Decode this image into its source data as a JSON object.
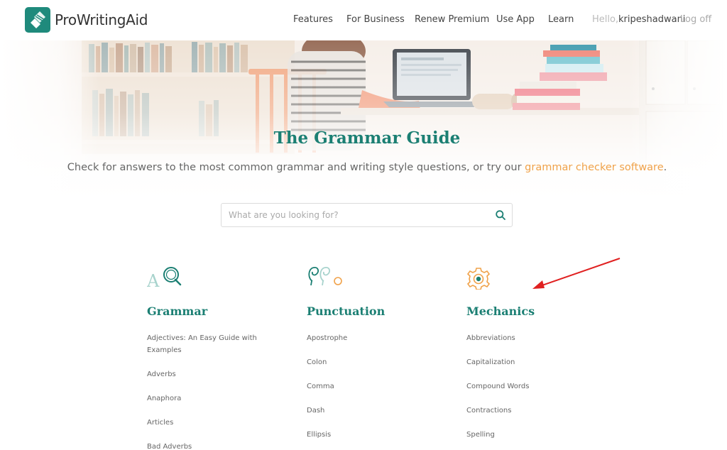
{
  "header": {
    "logo_text": "ProWritingAid",
    "nav": [
      "Features",
      "For Business",
      "Renew Premium",
      "Use App",
      "Learn"
    ],
    "hello": "Hello,",
    "username": "kripeshadwani",
    "logoff": "Log off"
  },
  "hero": {
    "title": "The Grammar Guide",
    "subtitle_prefix": "Check for answers to the most common grammar and writing style questions, or try our ",
    "subtitle_link": "grammar checker software",
    "subtitle_suffix": "."
  },
  "search": {
    "placeholder": "What are you looking for?"
  },
  "categories": [
    {
      "title": "Grammar",
      "icon": "grammar-aq-icon",
      "items": [
        "Adjectives: An Easy Guide with Examples",
        "Adverbs",
        "Anaphora",
        "Articles",
        "Bad Adverbs"
      ]
    },
    {
      "title": "Punctuation",
      "icon": "punctuation-marks-icon",
      "items": [
        "Apostrophe",
        "Colon",
        "Comma",
        "Dash",
        "Ellipsis"
      ]
    },
    {
      "title": "Mechanics",
      "icon": "gear-icon",
      "items": [
        "Abbreviations",
        "Capitalization",
        "Compound Words",
        "Contractions",
        "Spelling"
      ]
    }
  ],
  "colors": {
    "brand": "#1b7f73",
    "link_orange": "#f0a24a",
    "annotation_arrow": "#e02020"
  }
}
